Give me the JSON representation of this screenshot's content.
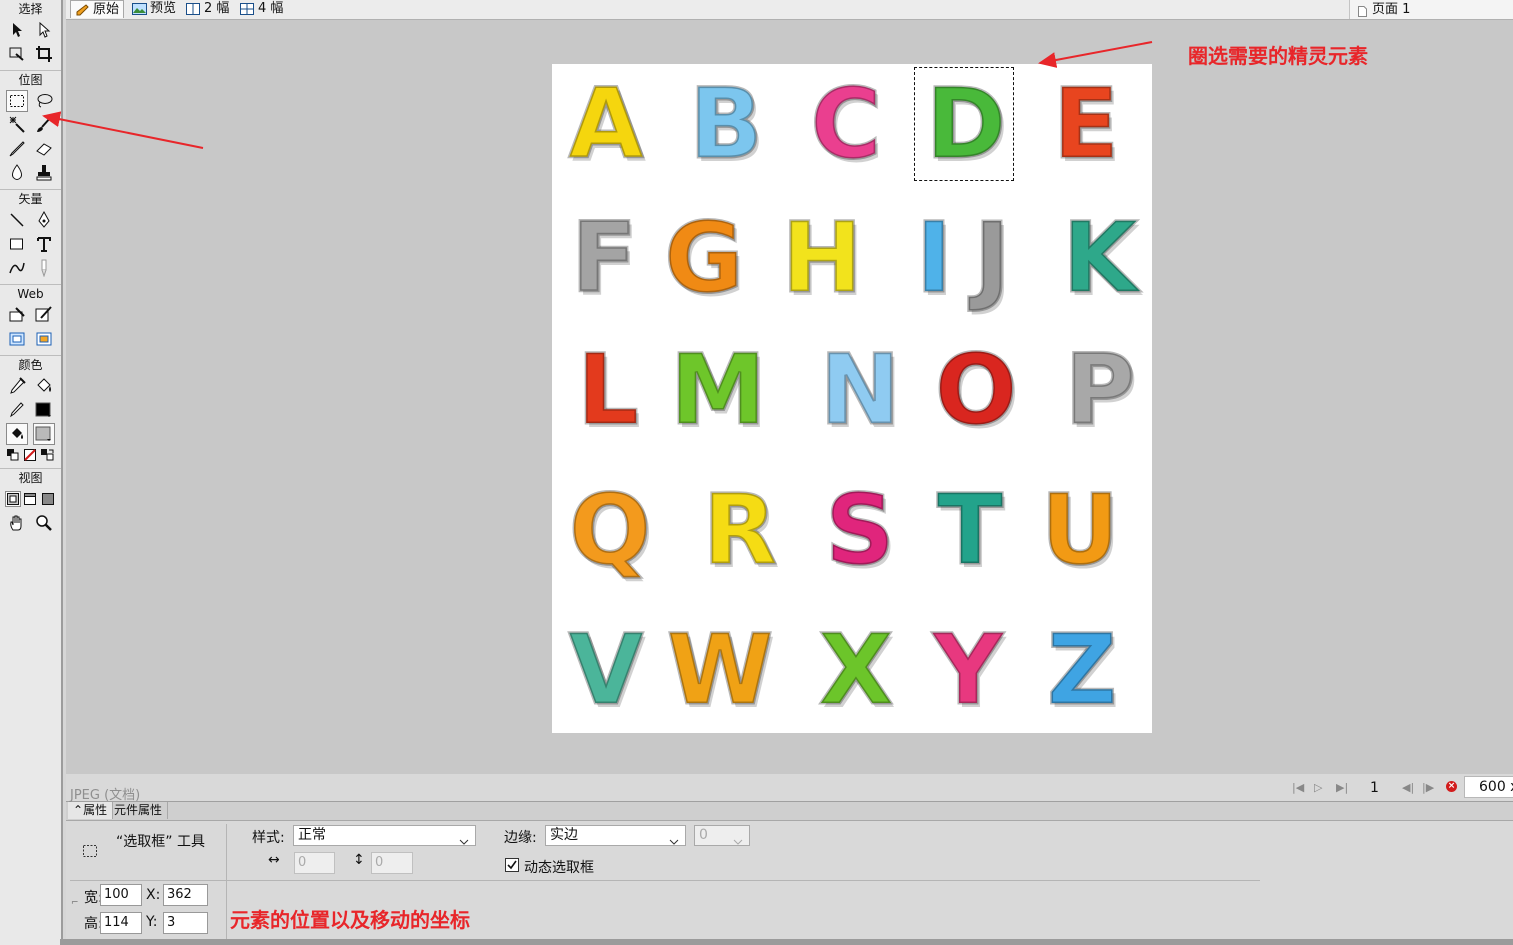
{
  "toolbox": {
    "sections": {
      "select": "选择",
      "bitmap": "位图",
      "vector": "矢量",
      "web": "Web",
      "colors": "颜色",
      "view": "视图"
    }
  },
  "tabs": {
    "original": "原始",
    "preview": "预览",
    "two_up": "2 幅",
    "four_up": "4 幅",
    "page": "页面 1"
  },
  "canvas": {
    "letters": [
      "A",
      "B",
      "C",
      "D",
      "E",
      "F",
      "G",
      "H",
      "I",
      "J",
      "K",
      "L",
      "M",
      "N",
      "O",
      "P",
      "Q",
      "R",
      "S",
      "T",
      "U",
      "V",
      "W",
      "X",
      "Y",
      "Z"
    ],
    "letter_colors": [
      "#f5d60e",
      "#7cc6ee",
      "#ea3f8f",
      "#49b93a",
      "#e8451f",
      "#a4a4a4",
      "#f08a14",
      "#f2e31c",
      "#4fb2e9",
      "#9a9a9a",
      "#2ea88a",
      "#e33a1d",
      "#6ec62a",
      "#8fcbf1",
      "#d9261f",
      "#a8a8a8",
      "#f39a1d",
      "#f5dc14",
      "#e0257c",
      "#23a38b",
      "#f29a14",
      "#4bb59a",
      "#f0a215",
      "#6cc52a",
      "#e8387f",
      "#3fa4e3"
    ]
  },
  "annotations": {
    "top": "圈选需要的精灵元素",
    "bottom": "元素的位置以及移动的坐标"
  },
  "status": {
    "doc_type": "JPEG (文档)",
    "page_number": "1",
    "zoom": "600 x"
  },
  "properties": {
    "tab_properties": "属性",
    "tab_symbol": "元件属性",
    "tool_name": "“选取框” 工具",
    "style_label": "样式:",
    "style_value": "正常",
    "edge_label": "边缘:",
    "edge_value": "实边",
    "edge_amount": "0",
    "fixed_w": "0",
    "fixed_h": "0",
    "dynamic_label": "动态选取框",
    "width_label": "宽:",
    "width_value": "100",
    "height_label": "高:",
    "height_value": "114",
    "x_label": "X:",
    "x_value": "362",
    "y_label": "Y:",
    "y_value": "3"
  }
}
